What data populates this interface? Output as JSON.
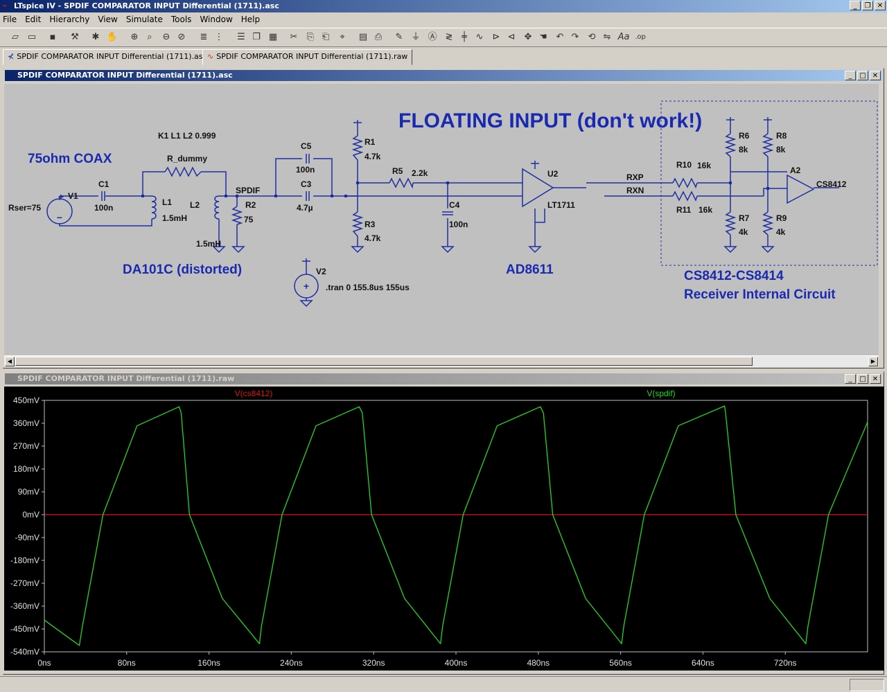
{
  "app": {
    "title": "LTspice IV - SPDIF COMPARATOR INPUT Differential (1711).asc",
    "menu": [
      "File",
      "Edit",
      "Hierarchy",
      "View",
      "Simulate",
      "Tools",
      "Window",
      "Help"
    ],
    "tabs": [
      "SPDIF COMPARATOR INPUT Differential (1711).asc",
      "SPDIF COMPARATOR INPUT Differential (1711).raw"
    ]
  },
  "schematic_window": {
    "title": "SPDIF COMPARATOR INPUT Differential (1711).asc",
    "labels": {
      "floating": "FLOATING INPUT (don't work!)",
      "coax": "75ohm COAX",
      "da101c": "DA101C (distorted)",
      "ad8611": "AD8611",
      "cs_title": "CS8412-CS8414",
      "cs_sub": "Receiver Internal Circuit",
      "kline": "K1 L1 L2 0.999",
      "tran": ".tran 0 155.8us 155us",
      "rser": "Rser=75",
      "spdif": "SPDIF",
      "rxp": "RXP",
      "rxn": "RXN",
      "cs8412": "CS8412"
    },
    "components": {
      "v1": "V1",
      "c1": "C1",
      "c1v": "100n",
      "rdummy": "R_dummy",
      "l1": "L1",
      "l1v": "1.5mH",
      "l2": "L2",
      "l2v": "1.5mH",
      "r2": "R2",
      "r2v": "75",
      "c5": "C5",
      "c5v": "100n",
      "c3": "C3",
      "c3v": "4.7µ",
      "r1": "R1",
      "r1v": "4.7k",
      "r3": "R3",
      "r3v": "4.7k",
      "r5": "R5",
      "r5v": "2.2k",
      "c4": "C4",
      "c4v": "100n",
      "u2": "U2",
      "u2v": "LT1711",
      "v2": "V2",
      "r10": "R10",
      "r10v": "16k",
      "r11": "R11",
      "r11v": "16k",
      "r6": "R6",
      "r6v": "8k",
      "r7": "R7",
      "r7v": "4k",
      "r8": "R8",
      "r8v": "8k",
      "r9": "R9",
      "r9v": "4k",
      "a2": "A2"
    }
  },
  "waveform_window": {
    "title": "SPDIF COMPARATOR INPUT Differential (1711).raw"
  },
  "chart_data": {
    "type": "line",
    "xlabel": "",
    "ylabel": "",
    "xlim": [
      0,
      800
    ],
    "ylim": [
      -540,
      450
    ],
    "grid": false,
    "y_ticks": [
      "450mV",
      "360mV",
      "270mV",
      "180mV",
      "90mV",
      "0mV",
      "-90mV",
      "-180mV",
      "-270mV",
      "-360mV",
      "-450mV",
      "-540mV"
    ],
    "x_ticks": [
      "0ns",
      "80ns",
      "160ns",
      "240ns",
      "320ns",
      "400ns",
      "480ns",
      "560ns",
      "640ns",
      "720ns"
    ],
    "series": [
      {
        "name": "V(cs8412)",
        "color": "#e01010",
        "x": [
          0,
          800
        ],
        "y": [
          0,
          0
        ]
      },
      {
        "name": "V(spdif)",
        "color": "#20d820",
        "x": [
          0,
          34,
          37,
          57,
          90,
          131,
          133,
          141,
          173,
          209,
          211,
          231,
          264,
          306,
          309,
          318,
          350,
          385,
          387,
          407,
          440,
          482,
          485,
          494,
          526,
          561,
          563,
          583,
          616,
          661,
          662,
          672,
          705,
          740,
          742,
          762,
          800
        ],
        "y": [
          -415,
          -515,
          -440,
          0,
          350,
          425,
          400,
          0,
          -330,
          -508,
          -440,
          0,
          350,
          425,
          400,
          0,
          -330,
          -508,
          -440,
          0,
          350,
          425,
          400,
          0,
          -330,
          -508,
          -440,
          0,
          350,
          428,
          400,
          0,
          -330,
          -508,
          -440,
          0,
          365
        ]
      }
    ]
  }
}
